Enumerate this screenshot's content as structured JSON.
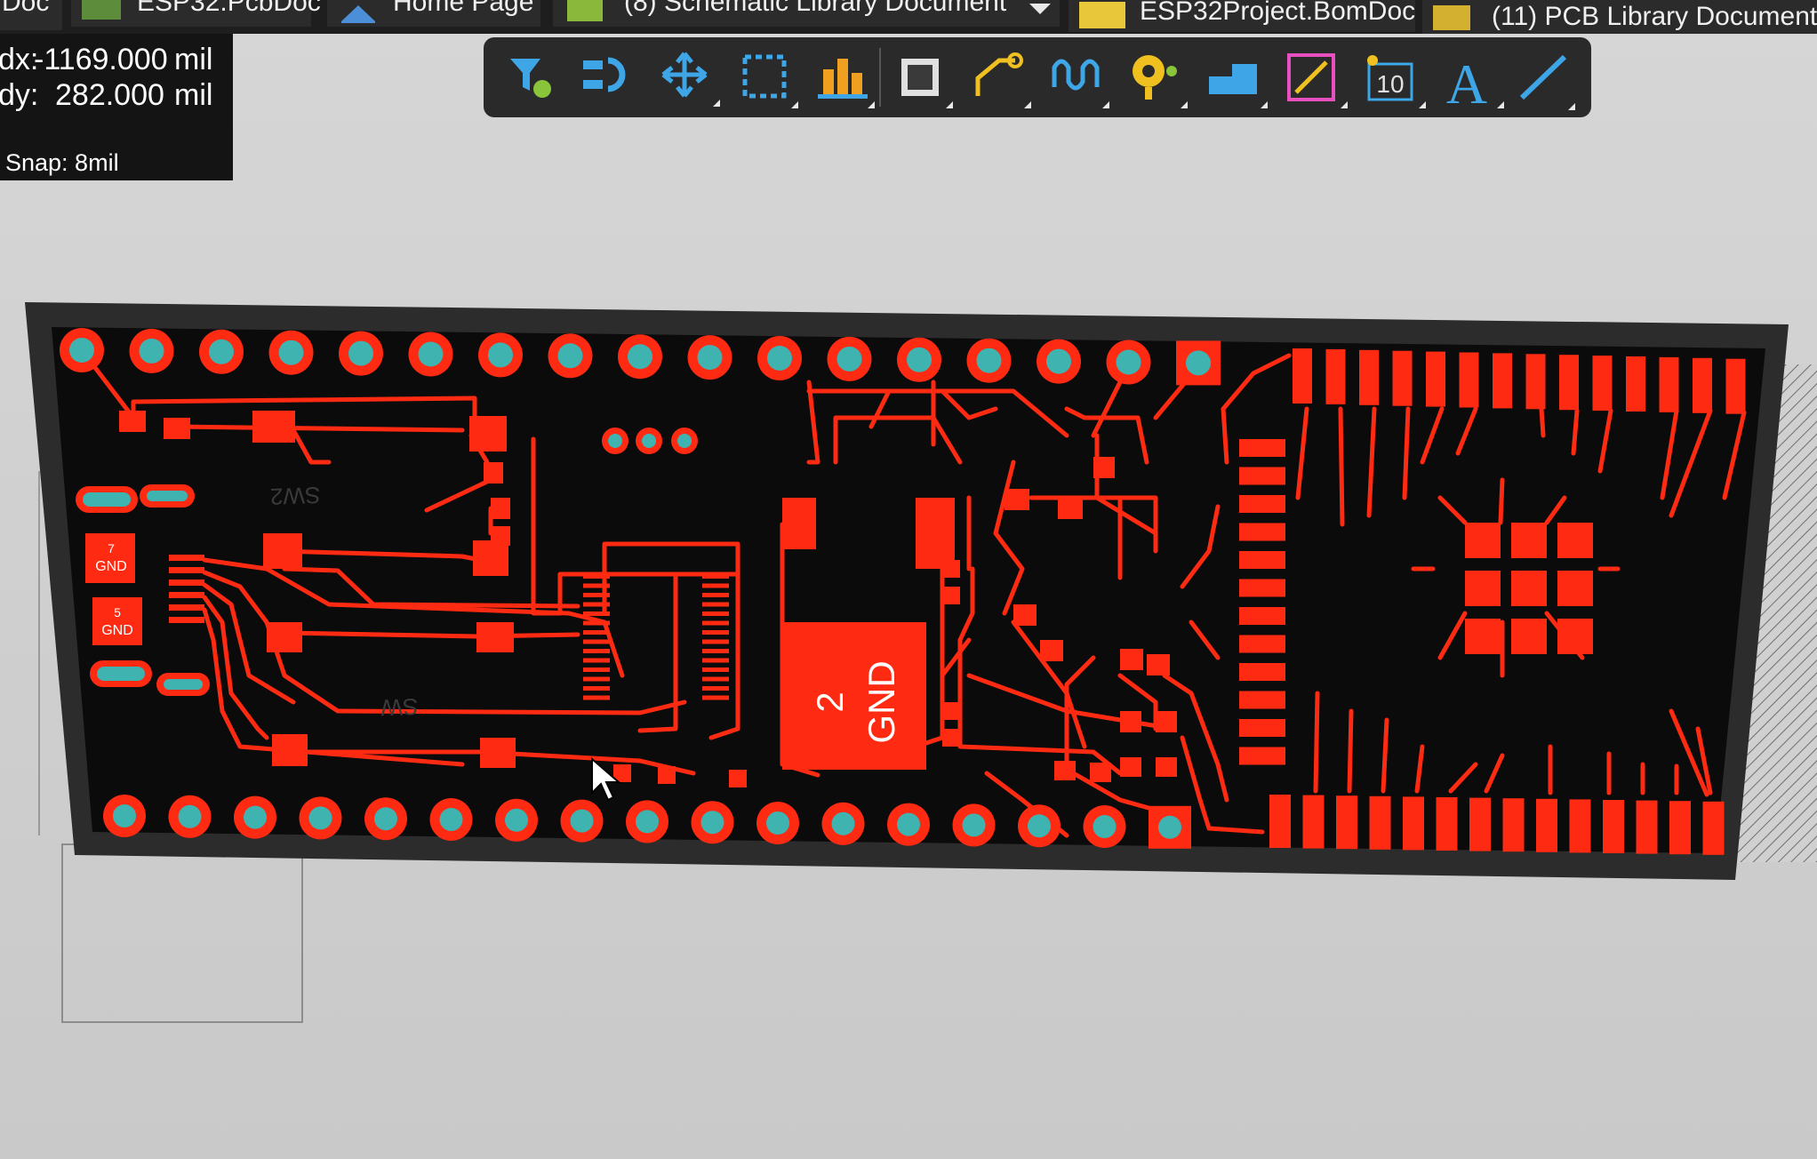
{
  "tabs": [
    {
      "label": "Doc"
    },
    {
      "label": "ESP32.PcbDoc"
    },
    {
      "label": "Home Page"
    },
    {
      "label": "(8) Schematic Library Document"
    },
    {
      "label": "ESP32Project.BomDoc"
    },
    {
      "label": "(11) PCB Library Document"
    }
  ],
  "coords": {
    "dx_label": "dx:",
    "dx_value": "-1169.000",
    "dx_unit": "mil",
    "dy_label": "dy:",
    "dy_value": "282.000",
    "dy_unit": "mil",
    "snap": "Snap: 8mil"
  },
  "toolbar": {
    "tools": [
      {
        "icon": "filter-icon"
      },
      {
        "icon": "interactive-route-connect-icon"
      },
      {
        "icon": "move-icon"
      },
      {
        "icon": "select-rectangle-icon"
      },
      {
        "icon": "align-icon"
      },
      {
        "icon": "place-component-icon"
      },
      {
        "icon": "interactive-routing-icon"
      },
      {
        "icon": "length-tuning-icon"
      },
      {
        "icon": "place-via-icon"
      },
      {
        "icon": "place-fill-icon"
      },
      {
        "icon": "place-line-icon"
      },
      {
        "icon": "place-string-icon"
      },
      {
        "icon": "place-text-icon"
      },
      {
        "icon": "place-track-icon"
      }
    ],
    "counter_label": "10",
    "text_tool_label": "A"
  },
  "pcb": {
    "labels": {
      "gnd_pad_number": "2",
      "gnd_pad_net": "GND",
      "small_pad_7_num": "7",
      "small_pad_7_net": "GND",
      "small_pad_5_num": "5",
      "small_pad_5_net": "GND",
      "silk_sw2": "SW2",
      "silk_sw": "SW"
    }
  },
  "colors": {
    "copper": "#ff2a12",
    "board": "#0b0b0b",
    "via_hole": "#3fb3b0",
    "toolbar": "#2a2a2a",
    "workspace": "#cfcfcf"
  }
}
